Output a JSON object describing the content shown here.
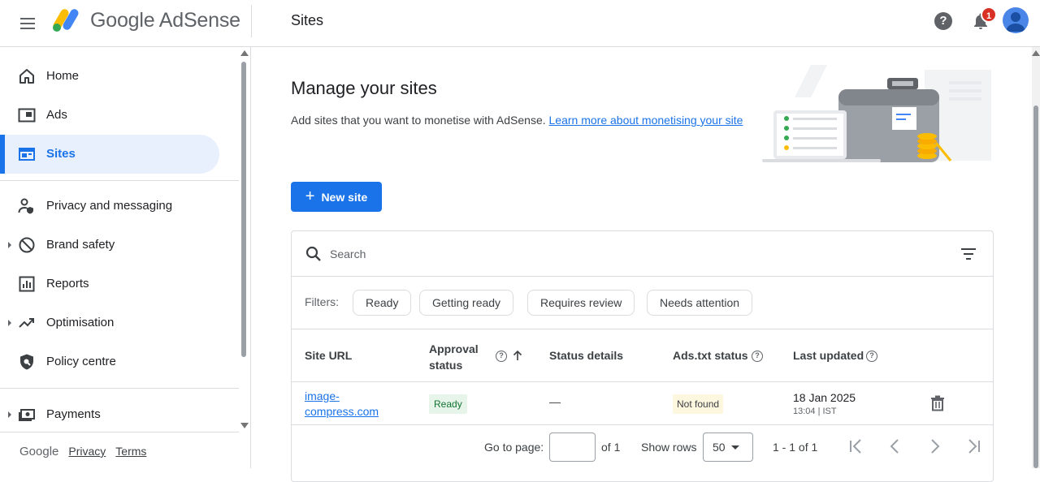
{
  "app": {
    "brand": "Google AdSense"
  },
  "header": {
    "page_title": "Sites",
    "notification_count": "1"
  },
  "sidebar": {
    "items": [
      {
        "label": "Home"
      },
      {
        "label": "Ads"
      },
      {
        "label": "Sites"
      },
      {
        "label": "Privacy and messaging"
      },
      {
        "label": "Brand safety"
      },
      {
        "label": "Reports"
      },
      {
        "label": "Optimisation"
      },
      {
        "label": "Policy centre"
      },
      {
        "label": "Payments"
      }
    ],
    "footer": {
      "google": "Google",
      "privacy": "Privacy",
      "terms": "Terms"
    }
  },
  "main": {
    "title": "Manage your sites",
    "description": "Add sites that you want to monetise with AdSense. ",
    "learn_more": "Learn more about monetising your site",
    "new_site_label": "New site",
    "search_placeholder": "Search",
    "filters_label": "Filters:",
    "filter_chips": [
      "Ready",
      "Getting ready",
      "Requires review",
      "Needs attention"
    ],
    "columns": {
      "site_url": "Site URL",
      "approval_line1": "Approval",
      "approval_line2": "status",
      "status_details": "Status details",
      "ads_txt": "Ads.txt status",
      "last_updated": "Last updated"
    },
    "rows": [
      {
        "url_line1": "image-",
        "url_line2": "compress.com",
        "approval": "Ready",
        "status_details": "—",
        "ads_txt": "Not found",
        "updated_date": "18 Jan 2025",
        "updated_time": "13:04 | IST"
      }
    ],
    "pager": {
      "goto_label": "Go to page:",
      "of_pages": "of 1",
      "show_rows_label": "Show rows",
      "rows_value": "50",
      "range": "1 - 1 of 1"
    }
  },
  "colors": {
    "accent": "#1a73e8",
    "ready_bg": "#e6f4ea",
    "not_found_bg": "#fef7e0",
    "badge_red": "#d93025"
  }
}
